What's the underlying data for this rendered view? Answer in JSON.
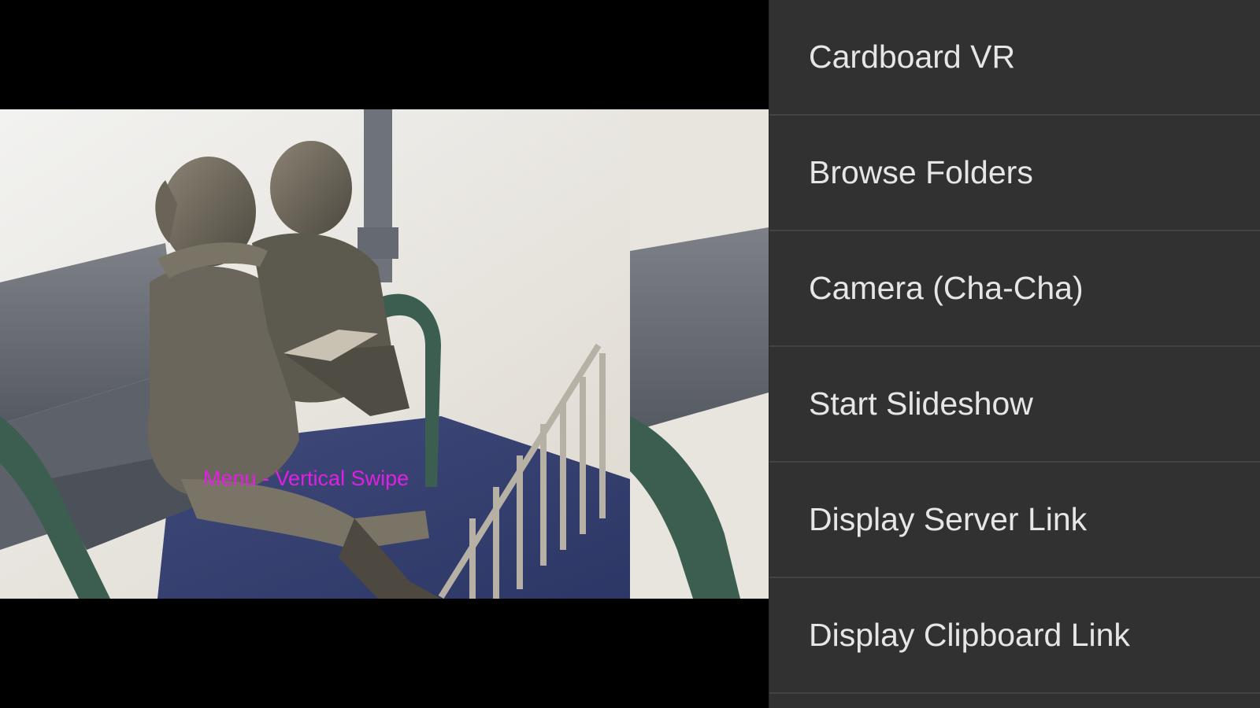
{
  "viewer": {
    "hint_text": "Menu - Vertical Swipe",
    "photo_description_icon": "photo-statue-children-reading"
  },
  "menu": {
    "items": [
      {
        "label": "Cardboard VR"
      },
      {
        "label": "Browse Folders"
      },
      {
        "label": "Camera (Cha-Cha)"
      },
      {
        "label": "Start Slideshow"
      },
      {
        "label": "Display Server Link"
      },
      {
        "label": "Display Clipboard Link"
      }
    ]
  },
  "colors": {
    "menu_background": "#313131",
    "menu_divider": "#434343",
    "menu_text": "#e6e6e6",
    "hint_text": "#e020e0",
    "viewer_background": "#000000"
  }
}
